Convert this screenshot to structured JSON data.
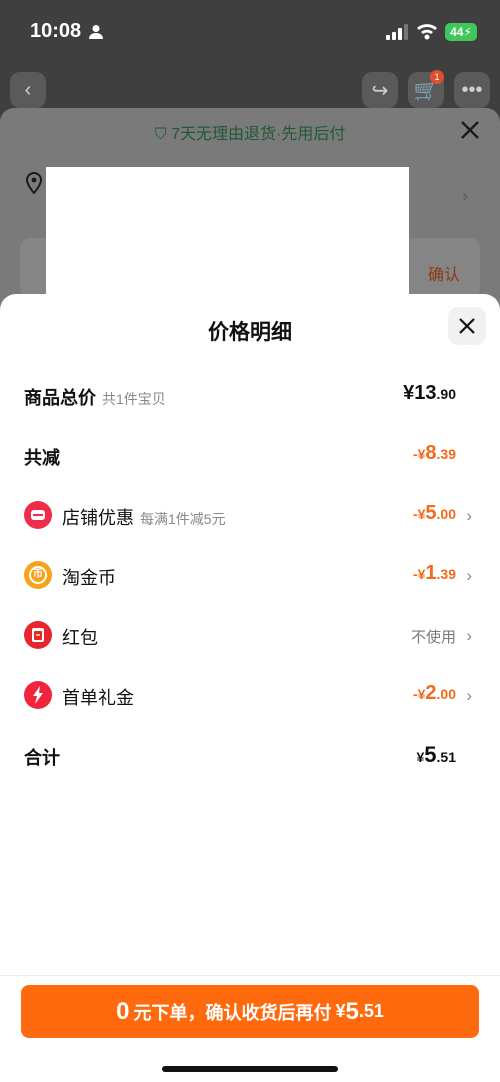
{
  "status_bar": {
    "time": "10:08",
    "battery": "44"
  },
  "background": {
    "cart_badge": "1",
    "guarantee": "7天无理由退货·先用后付",
    "confirm": "确认"
  },
  "sheet": {
    "title": "价格明细",
    "rows": [
      {
        "label": "商品总价",
        "sub": "共1件宝贝",
        "value_prefix": "¥",
        "value_int": "13",
        "value_dec": ".90"
      },
      {
        "label": "共减",
        "value_prefix": "-¥",
        "value_int": "8",
        "value_dec": ".39"
      },
      {
        "label": "店铺优惠",
        "sub": "每满1件减5元",
        "value_prefix": "-¥",
        "value_int": "5",
        "value_dec": ".00",
        "icon": "store-icon"
      },
      {
        "label": "淘金币",
        "value_prefix": "-¥",
        "value_int": "1",
        "value_dec": ".39",
        "icon": "coin-icon"
      },
      {
        "label": "红包",
        "value_text": "不使用",
        "icon": "red-envelope-icon"
      },
      {
        "label": "首单礼金",
        "value_prefix": "-¥",
        "value_int": "2",
        "value_dec": ".00",
        "icon": "lightning-icon"
      },
      {
        "label": "合计",
        "value_prefix": "¥",
        "value_int": "5",
        "value_dec": ".51"
      }
    ]
  },
  "cta": {
    "lead": "0",
    "middle": "元下单，确认收货后再付",
    "currency": "¥",
    "amount_int": "5",
    "amount_dec": ".51"
  },
  "colors": {
    "accent": "#ff6a0f",
    "discount": "#f26a1b",
    "battery": "#40c75a"
  }
}
